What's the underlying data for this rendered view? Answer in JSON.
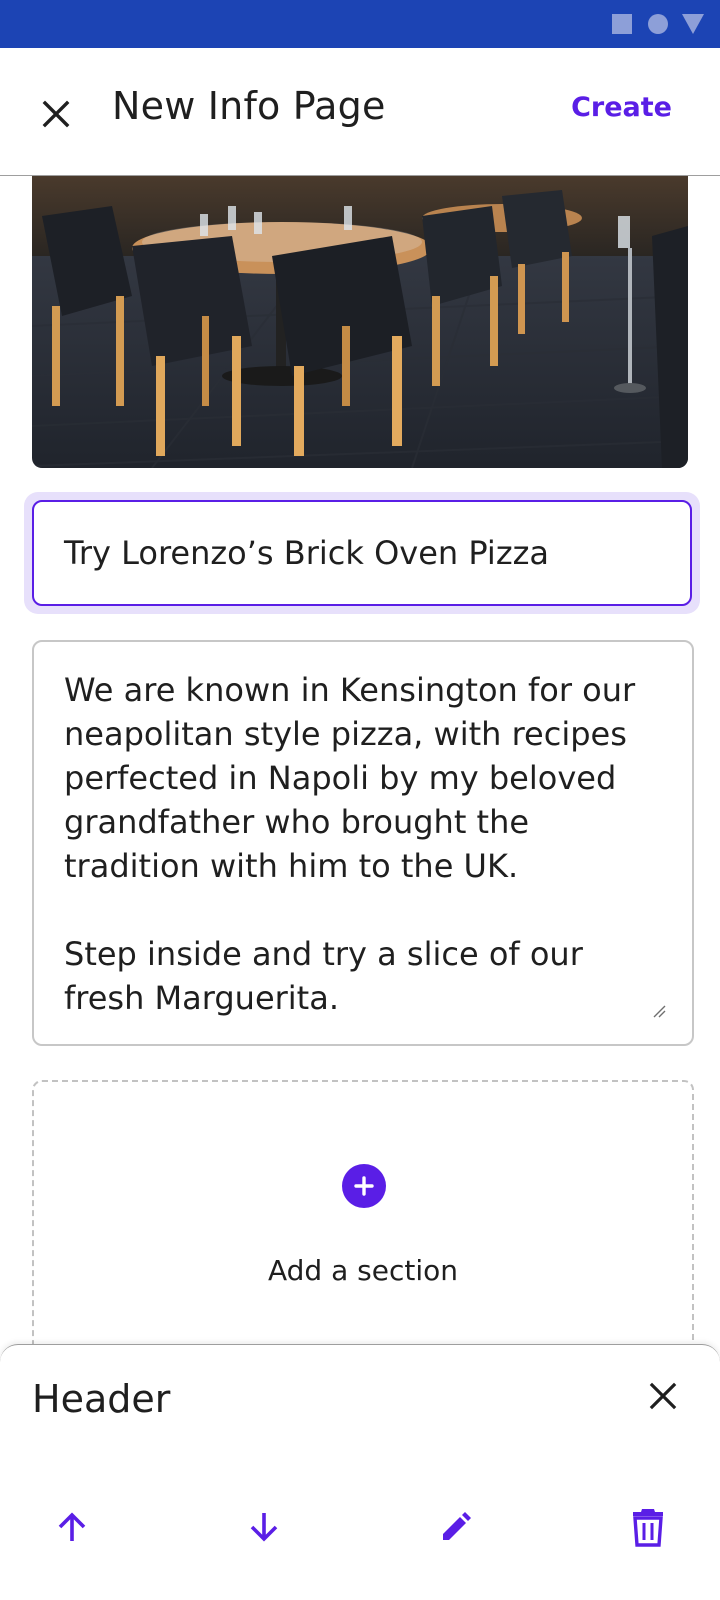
{
  "app_bar": {
    "title": "New Info Page",
    "create_label": "Create"
  },
  "form": {
    "title_value": "Try Lorenzo’s Brick Oven Pizza",
    "body_lines": [
      "We are known in Kensington for our",
      "neapolitan style pizza, with recipes",
      "perfected in Napoli by my beloved",
      "grandfather who brought the",
      "tradition with him to the UK.",
      "",
      "Step inside and try a slice of our",
      "fresh Marguerita."
    ]
  },
  "add_section": {
    "label": "Add a section"
  },
  "bottom_sheet": {
    "title": "Header",
    "actions": [
      "arrow-up-icon",
      "arrow-down-icon",
      "pencil-icon",
      "trash-icon"
    ]
  },
  "colors": {
    "status_bar": "#1c44b4",
    "accent": "#5a1ee6",
    "focus_ring": "#e7e0fb"
  }
}
